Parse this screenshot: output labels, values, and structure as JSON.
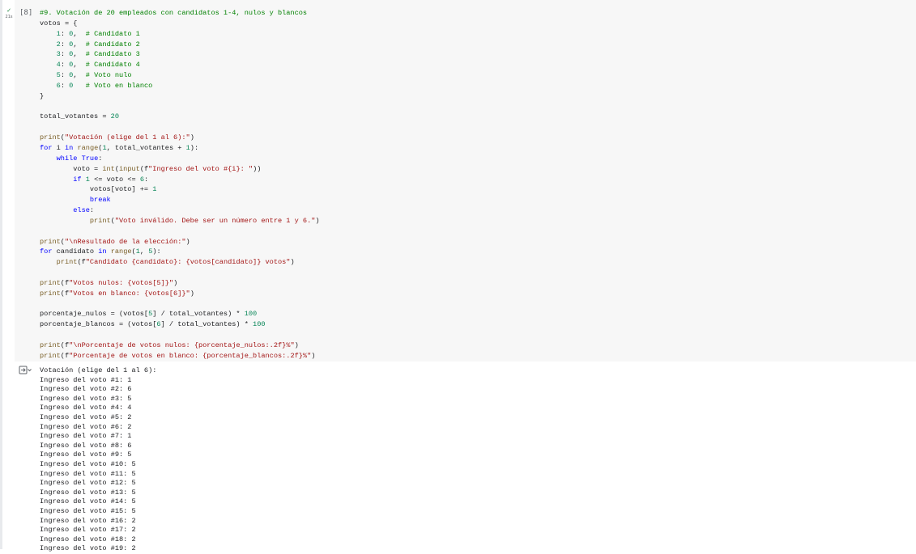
{
  "cell": {
    "execution_count": "[8]",
    "run_status_icon": "check-icon",
    "run_time": "21s",
    "code_lines": [
      "#9. Votación de 20 empleados con candidatos 1-4, nulos y blancos",
      "votos = {",
      "    1: 0,  # Candidato 1",
      "    2: 0,  # Candidato 2",
      "    3: 0,  # Candidato 3",
      "    4: 0,  # Candidato 4",
      "    5: 0,  # Voto nulo",
      "    6: 0   # Voto en blanco",
      "}",
      "",
      "total_votantes = 20",
      "",
      "print(\"Votación (elige del 1 al 6):\")",
      "for i in range(1, total_votantes + 1):",
      "    while True:",
      "        voto = int(input(f\"Ingreso del voto #{i}: \"))",
      "        if 1 <= voto <= 6:",
      "            votos[voto] += 1",
      "            break",
      "        else:",
      "            print(\"Voto inválido. Debe ser un número entre 1 y 6.\")",
      "",
      "print(\"\\nResultado de la elección:\")",
      "for candidato in range(1, 5):",
      "    print(f\"Candidato {candidato}: {votos[candidato]} votos\")",
      "",
      "print(f\"Votos nulos: {votos[5]}\")",
      "print(f\"Votos en blanco: {votos[6]}\")",
      "",
      "porcentaje_nulos = (votos[5] / total_votantes) * 100",
      "porcentaje_blancos = (votos[6] / total_votantes) * 100",
      "",
      "print(f\"\\nPorcentaje de votos nulos: {porcentaje_nulos:.2f}%\")",
      "print(f\"Porcentaje de votos en blanco: {porcentaje_blancos:.2f}%\")"
    ]
  },
  "output": {
    "icon": "output-expand-icon",
    "lines": [
      "Votación (elige del 1 al 6):",
      "Ingreso del voto #1: 1",
      "Ingreso del voto #2: 6",
      "Ingreso del voto #3: 5",
      "Ingreso del voto #4: 4",
      "Ingreso del voto #5: 2",
      "Ingreso del voto #6: 2",
      "Ingreso del voto #7: 1",
      "Ingreso del voto #8: 6",
      "Ingreso del voto #9: 5",
      "Ingreso del voto #10: 5",
      "Ingreso del voto #11: 5",
      "Ingreso del voto #12: 5",
      "Ingreso del voto #13: 5",
      "Ingreso del voto #14: 5",
      "Ingreso del voto #15: 5",
      "Ingreso del voto #16: 2",
      "Ingreso del voto #17: 2",
      "Ingreso del voto #18: 2",
      "Ingreso del voto #19: 2"
    ]
  }
}
